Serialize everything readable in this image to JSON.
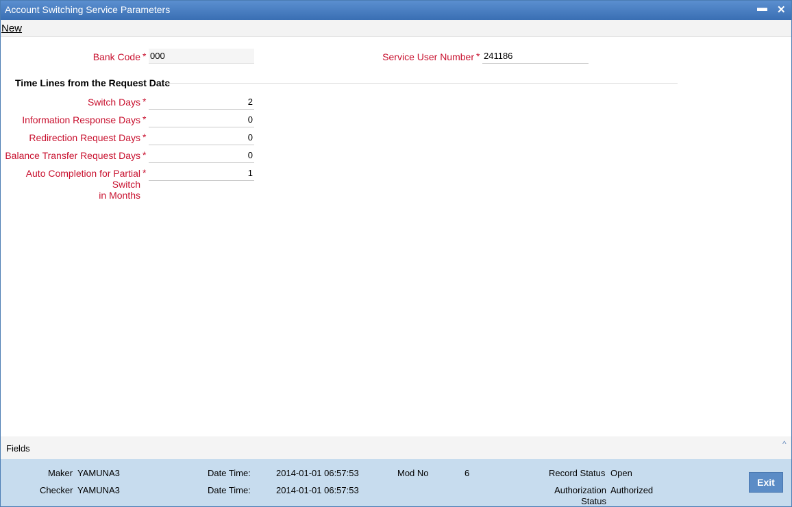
{
  "window": {
    "title": "Account Switching Service Parameters",
    "minimize_glyph": "▬",
    "close_glyph": "✕"
  },
  "toolbar": {
    "new_label": "New"
  },
  "form": {
    "required_marker": "*",
    "bank_code": {
      "label": "Bank Code",
      "value": "000"
    },
    "service_user_number": {
      "label": "Service User Number",
      "value": "241186"
    },
    "section_title": "Time Lines from the Request Date",
    "switch_days": {
      "label": "Switch Days",
      "value": "2"
    },
    "information_response_days": {
      "label": "Information Response Days",
      "value": "0"
    },
    "redirection_request_days": {
      "label": "Redirection Request Days",
      "value": "0"
    },
    "balance_transfer_request_days": {
      "label": "Balance Transfer Request Days",
      "value": "0"
    },
    "auto_completion": {
      "label_line1": "Auto Completion for Partial Switch",
      "label_line2": "in Months",
      "value": "1"
    }
  },
  "fields_bar": {
    "label": "Fields",
    "caret_glyph": "^"
  },
  "footer": {
    "maker_label": "Maker",
    "maker_value": "YAMUNA3",
    "checker_label": "Checker",
    "checker_value": "YAMUNA3",
    "datetime_label": "Date Time:",
    "maker_datetime": "2014-01-01 06:57:53",
    "checker_datetime": "2014-01-01 06:57:53",
    "mod_no_label": "Mod No",
    "mod_no_value": "6",
    "record_status_label": "Record Status",
    "record_status_value": "Open",
    "auth_status_label_line1": "Authorization",
    "auth_status_label_line2": "Status",
    "auth_status_value": "Authorized",
    "exit_label": "Exit"
  },
  "colors": {
    "titlebar": "#3a6fb4",
    "label_red": "#c8102e",
    "footer_bg": "#c7dcee",
    "exit_button": "#5b8cc6"
  }
}
